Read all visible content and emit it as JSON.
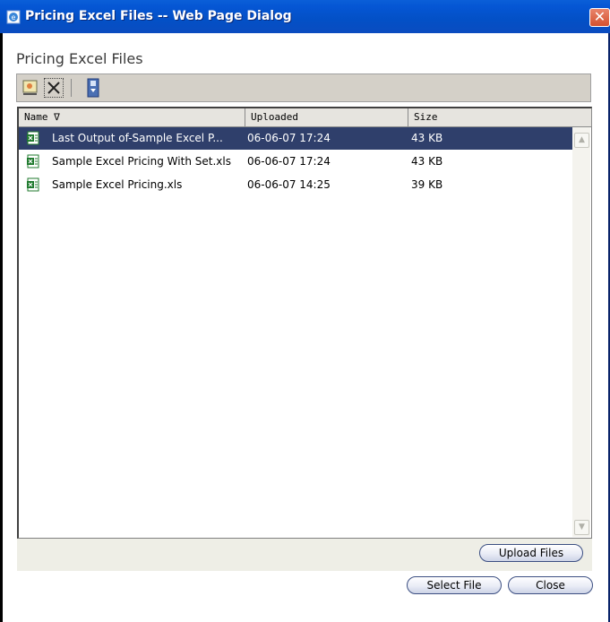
{
  "window": {
    "title": "Pricing Excel Files -- Web Page Dialog",
    "close_glyph": "✕"
  },
  "page": {
    "title": "Pricing Excel Files"
  },
  "toolbar": {
    "buttons": [
      {
        "name": "open-icon"
      },
      {
        "name": "delete-icon"
      },
      {
        "name": "download-icon"
      }
    ]
  },
  "list": {
    "columns": [
      "Name ∇",
      "Uploaded",
      "Size"
    ],
    "rows": [
      {
        "name": "Last Output of-Sample Excel P...",
        "uploaded": "06-06-07 17:24",
        "size": "43 KB",
        "selected": true
      },
      {
        "name": "Sample Excel Pricing With Set.xls",
        "uploaded": "06-06-07 17:24",
        "size": "43 KB",
        "selected": false
      },
      {
        "name": "Sample Excel Pricing.xls",
        "uploaded": "06-06-07 14:25",
        "size": "39 KB",
        "selected": false
      }
    ]
  },
  "buttons": {
    "upload": "Upload Files",
    "select": "Select File",
    "close": "Close"
  },
  "colors": {
    "selected_row": "#2f3f6b",
    "titlebar": "#0350c6",
    "excel_icon": "#1f7a2e"
  }
}
